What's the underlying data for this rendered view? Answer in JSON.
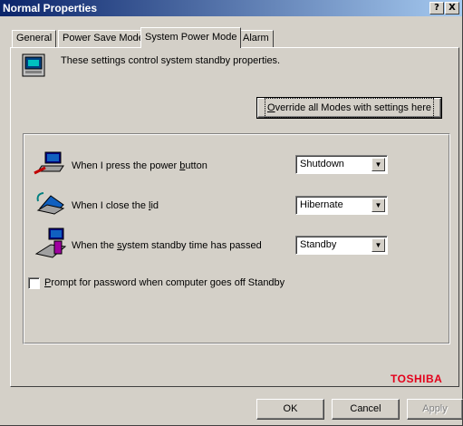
{
  "window": {
    "title": "Normal Properties",
    "help_btn": "?",
    "close_btn": "X"
  },
  "tabs": [
    "General",
    "Power Save Mode",
    "System Power Mode",
    "Alarm"
  ],
  "active_tab": "System Power Mode",
  "description": "These settings control system standby properties.",
  "override": {
    "pre": "",
    "u": "O",
    "rest": "verride all Modes with settings here"
  },
  "rows": [
    {
      "icon": "power-button-laptop-icon",
      "pre": "When I press the power ",
      "u": "b",
      "rest": "utton",
      "value": "Shutdown"
    },
    {
      "icon": "lid-close-icon",
      "pre": "When I close the ",
      "u": "l",
      "rest": "id",
      "value": "Hibernate"
    },
    {
      "icon": "standby-timer-icon",
      "pre": "When the ",
      "u": "s",
      "rest": "ystem standby time has passed",
      "value": "Standby"
    }
  ],
  "password": {
    "checked": false,
    "u": "P",
    "rest": "rompt for password when computer goes off Standby"
  },
  "brand": "TOSHIBA",
  "footer": {
    "ok": "OK",
    "cancel": "Cancel",
    "apply": "Apply"
  }
}
